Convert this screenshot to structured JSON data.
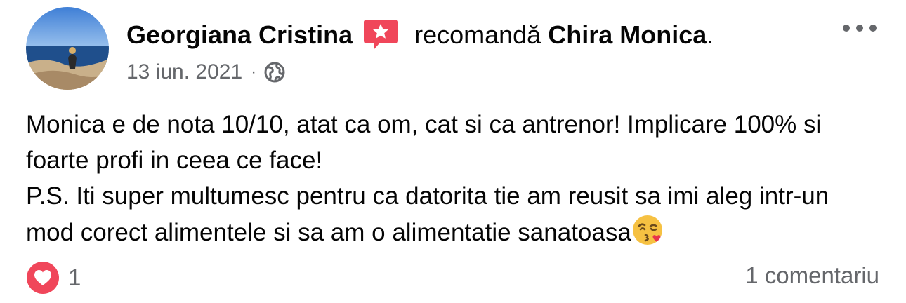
{
  "post": {
    "author": "Georgiana Cristina",
    "recommend_verb": "recomandă",
    "recommended_page": "Chira Monica",
    "period": ".",
    "date": "13 iun. 2021",
    "separator": "·",
    "audience_icon": "globe-icon",
    "recommend_icon": "recommend-star-badge-icon",
    "more_icon": "more-options-icon",
    "body": {
      "line1": "Monica e de nota 10/10, atat ca om, cat si ca antrenor! Implicare 100% si foarte profi in ceea ce face!",
      "line2": "P.S. Iti super multumesc pentru ca datorita tie am reusit sa imi aleg intr-un mod corect alimentele si sa am o alimentatie sanatoasa",
      "emoji": "face-blowing-a-kiss-emoji"
    },
    "reactions": {
      "icon": "love-reaction-icon",
      "count": "1"
    },
    "comments_label": "1 comentariu"
  },
  "colors": {
    "primary_text": "#050505",
    "secondary_text": "#65676b",
    "recommend_badge": "#f0465a",
    "love_reaction": "#f0465a"
  }
}
